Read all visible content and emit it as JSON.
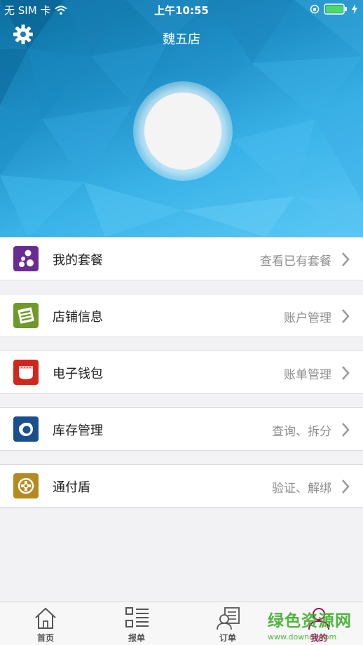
{
  "status_bar": {
    "carrier": "无 SIM 卡",
    "time": "上午10:55"
  },
  "header": {
    "store_name": "魏五店",
    "settings_icon": "gear-icon",
    "gradient_colors": [
      "#0b6fa0",
      "#3ab3e8",
      "#5bc8f5"
    ]
  },
  "menu": {
    "items": [
      {
        "label": "我的套餐",
        "detail": "查看已有套餐",
        "icon": "package-icon",
        "color": "#6a2c91"
      },
      {
        "label": "店铺信息",
        "detail": "账户管理",
        "icon": "store-info-icon",
        "color": "#6f9a2b"
      },
      {
        "label": "电子钱包",
        "detail": "账单管理",
        "icon": "wallet-icon",
        "color": "#d0271c"
      },
      {
        "label": "库存管理",
        "detail": "查询、拆分",
        "icon": "inventory-icon",
        "color": "#1a4f8e"
      },
      {
        "label": "通付盾",
        "detail": "验证、解绑",
        "icon": "shield-icon",
        "color": "#b58a1f"
      }
    ]
  },
  "tabbar": {
    "tabs": [
      {
        "label": "首页",
        "icon": "home-icon"
      },
      {
        "label": "报单",
        "icon": "report-icon"
      },
      {
        "label": "订单",
        "icon": "order-icon"
      },
      {
        "label": "我的",
        "icon": "profile-icon",
        "active": true
      }
    ],
    "active_color": "#a0105c"
  },
  "watermark": {
    "text": "绿色资源网",
    "url": "www.downcc.com"
  }
}
